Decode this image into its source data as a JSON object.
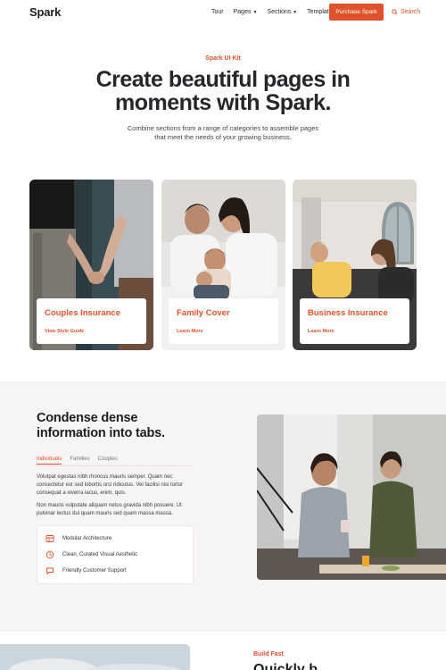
{
  "nav": {
    "logo": "Spark",
    "links": [
      {
        "label": "Tour",
        "dropdown": false
      },
      {
        "label": "Pages",
        "dropdown": true
      },
      {
        "label": "Sections",
        "dropdown": true
      },
      {
        "label": "Template",
        "dropdown": true
      }
    ],
    "purchase_label": "Purchase Spark",
    "search_label": "Search"
  },
  "hero": {
    "eyebrow": "Spark UI Kit",
    "title": "Create beautiful pages in moments with Spark.",
    "subtitle": "Combine sections from a range of categories to assemble pages that meet the needs of your growing business."
  },
  "cards": [
    {
      "title": "Couples Insurance",
      "link": "View Style Guide"
    },
    {
      "title": "Family Cover",
      "link": "Learn More"
    },
    {
      "title": "Business Insurance",
      "link": "Learn More"
    }
  ],
  "tabs_section": {
    "title": "Condense dense information into tabs.",
    "tabs": [
      "Individuals",
      "Families",
      "Couples"
    ],
    "active_tab": "Individuals",
    "paragraph_1": "Volutpat egestas nibh rhoncus mauris semper. Quam nec consectetur est sed lobortis orci ridiculus. Vel facilisi nisi tortor consequat a viverra lacus, enim, quis.",
    "paragraph_2": "Non mauris vulputate aliquam netus gravida nibh posuere. Ut pulvinar lectus dui quam mauris sed quam massa massa.",
    "features": [
      {
        "label": "Modular Architecture",
        "icon": "layout-icon"
      },
      {
        "label": "Clean, Curated Visual Aesthetic",
        "icon": "compass-icon"
      },
      {
        "label": "Friendly Customer Support",
        "icon": "chat-icon"
      }
    ]
  },
  "bottom": {
    "eyebrow": "Build Fast",
    "heading": "Quickly b..."
  },
  "colors": {
    "accent": "#e0522b",
    "section_bg": "#f7f5f3"
  }
}
